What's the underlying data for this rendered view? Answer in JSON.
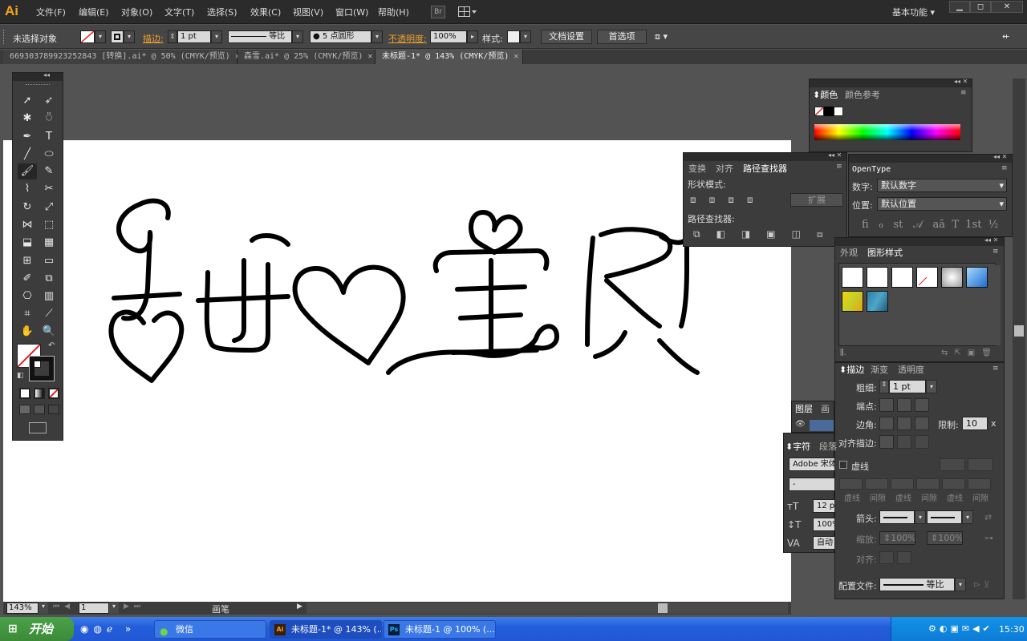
{
  "app": {
    "logo": "Ai",
    "accent": "#f7a21b"
  },
  "menu": {
    "items": [
      "文件(F)",
      "编辑(E)",
      "对象(O)",
      "文字(T)",
      "选择(S)",
      "效果(C)",
      "视图(V)",
      "窗口(W)",
      "帮助(H)"
    ],
    "bridge_label": "Br",
    "workspace": "基本功能",
    "window_controls": [
      "minimize",
      "maximize",
      "close"
    ]
  },
  "control_bar": {
    "selection": "未选择对象",
    "stroke_label": "描边:",
    "stroke_weight": "1 pt",
    "profile": "等比",
    "brush": "5 点圆形",
    "opacity_label": "不透明度:",
    "opacity": "100%",
    "style_label": "样式:",
    "doc_setup": "文档设置",
    "preferences": "首选项"
  },
  "tabs": [
    {
      "label": "669303789923252843 [转换].ai* @ 50% (CMYK/预览)",
      "active": false
    },
    {
      "label": "森雪.ai* @ 25% (CMYK/预览)",
      "active": false
    },
    {
      "label": "未标题-1* @ 143% (CMYK/预览)",
      "active": true
    }
  ],
  "canvas": {
    "artwork_text": "甜心宝贝"
  },
  "color_panel": {
    "tabs": [
      "颜色",
      "颜色参考"
    ]
  },
  "pathfinder_panel": {
    "tabs": [
      "变换",
      "对齐",
      "路径查找器"
    ],
    "shape_modes": "形状模式:",
    "expand": "扩展",
    "pathfinders": "路径查找器:"
  },
  "opentype_panel": {
    "tab": "OpenType",
    "figure_label": "数字:",
    "figure_value": "默认数字",
    "position_label": "位置:",
    "position_value": "默认位置",
    "glyphs": [
      "fi",
      "ℴ",
      "st",
      "𝒜",
      "aā",
      "T",
      "1st",
      "½"
    ]
  },
  "appearance_panel": {
    "tabs": [
      "外观",
      "图形样式"
    ]
  },
  "stroke_panel": {
    "tabs": [
      "描边",
      "渐变",
      "透明度"
    ],
    "weight_label": "粗细:",
    "weight_value": "1 pt",
    "cap_label": "端点:",
    "corner_label": "边角:",
    "limit_label": "限制:",
    "limit_value": "10",
    "limit_unit": "x",
    "align_label": "对齐描边:",
    "dashed_label": "虚线",
    "dash_labels": [
      "虚线",
      "间隙",
      "虚线",
      "间隙",
      "虚线",
      "间隙"
    ],
    "arrow_label": "箭头:",
    "scale_label": "缩放:",
    "scale_a": "100%",
    "scale_b": "100%",
    "align2_label": "对齐:",
    "profile_label": "配置文件:",
    "profile_value": "等比"
  },
  "layers_panel": {
    "tabs": [
      "图层",
      "画"
    ]
  },
  "character_panel": {
    "tabs": [
      "字符",
      "段落"
    ],
    "font": "Adobe 宋体",
    "style": "-",
    "size": "12 p",
    "leading": "100%",
    "tracking": "自动"
  },
  "status_bar": {
    "zoom": "143%",
    "page": "1",
    "tool_name": "画笔"
  },
  "taskbar": {
    "start": "开始",
    "items": [
      {
        "label": "微信",
        "active": false
      },
      {
        "label": "未标题-1* @ 143% (...",
        "active": true
      },
      {
        "label": "未标题-1 @ 100% (...",
        "active": false
      }
    ],
    "clock": "15:30"
  }
}
